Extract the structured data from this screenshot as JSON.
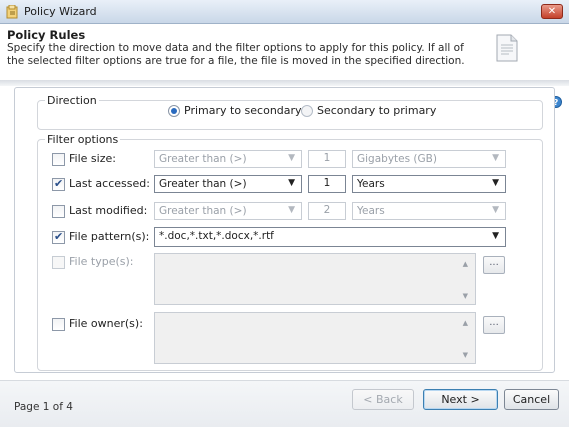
{
  "window": {
    "title": "Policy Wizard",
    "close_label": "✕"
  },
  "header": {
    "title": "Policy Rules",
    "description": "Specify the direction to move data and the filter options to apply for this policy. If all of the selected filter options are true for a file, the file is moved in the specified direction."
  },
  "direction": {
    "legend": "Direction",
    "option1": "Primary to secondary",
    "option2": "Secondary to primary",
    "selected": "Primary to secondary"
  },
  "filters": {
    "legend": "Filter options",
    "file_size": {
      "label": "File size:",
      "checked": false,
      "operator": "Greater than (>)",
      "value": "1",
      "unit": "Gigabytes (GB)"
    },
    "last_accessed": {
      "label": "Last accessed:",
      "checked": true,
      "operator": "Greater than (>)",
      "value": "1",
      "unit": "Years"
    },
    "last_modified": {
      "label": "Last modified:",
      "checked": false,
      "operator": "Greater than (>)",
      "value": "2",
      "unit": "Years"
    },
    "file_pattern": {
      "label": "File pattern(s):",
      "checked": true,
      "value": "*.doc,*.txt,*.docx,*.rtf"
    },
    "file_type": {
      "label": "File type(s):",
      "checked": false,
      "browse_label": "..."
    },
    "file_owner": {
      "label": "File owner(s):",
      "checked": false,
      "browse_label": "..."
    }
  },
  "footer": {
    "page_info": "Page 1 of 4",
    "back_label": "< Back",
    "next_label": "Next >",
    "cancel_label": "Cancel"
  },
  "icons": {
    "app": "policy-wizard-icon",
    "document": "document-icon",
    "help": "help-icon",
    "dropdown": "dropdown-arrow-icon"
  },
  "colors": {
    "accent": "#2a6bbf",
    "close": "#c4402a",
    "default_button_border": "#3c7fb1"
  }
}
